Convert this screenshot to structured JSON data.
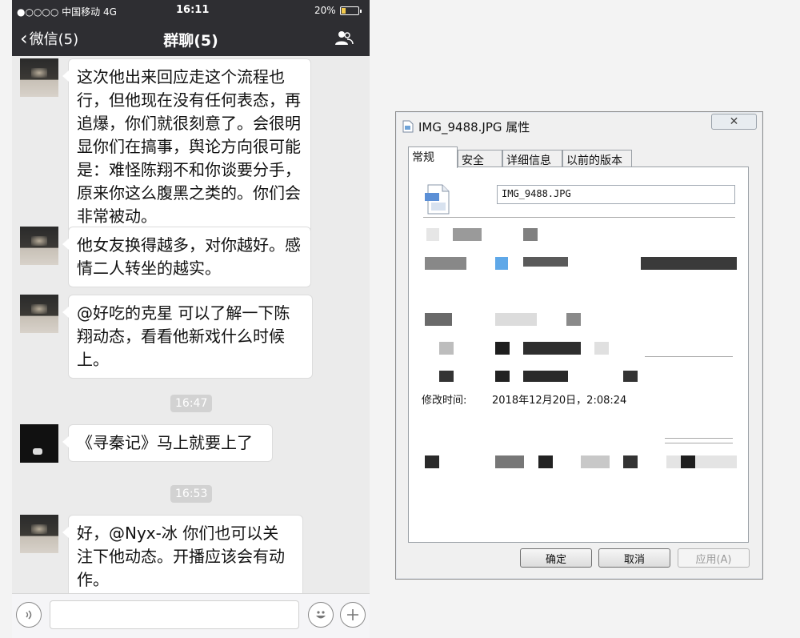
{
  "phone": {
    "status": {
      "carrier": "●○○○○ 中国移动  4G",
      "time": "16:11",
      "battery": "20%"
    },
    "nav": {
      "back_label": "微信(5)",
      "title": "群聊(5)"
    },
    "messages": [
      {
        "text": "这次他出来回应走这个流程也行，但他现在没有任何表态，再追爆，你们就很刻意了。会很明显你们在搞事，舆论方向很可能是：难怪陈翔不和你谈要分手，原来你这么腹黑之类的。你们会非常被动。"
      },
      {
        "text": "他女友换得越多，对你越好。感情二人转坐的越实。"
      },
      {
        "text": "@好吃的克星 可以了解一下陈翔动态，看看他新戏什么时候上。"
      },
      {
        "text": "《寻秦记》马上就要上了"
      },
      {
        "text": "好，@Nyx-冰 你们也可以关注下他动态。开播应该会有动作。"
      }
    ],
    "timestamps": [
      "16:47",
      "16:53"
    ],
    "input_placeholder": ""
  },
  "dialog": {
    "title": "IMG_9488.JPG 属性",
    "tabs": [
      "常规",
      "安全",
      "详细信息",
      "以前的版本"
    ],
    "filename": "IMG_9488.JPG",
    "modified_label": "修改时间:",
    "modified_value": "2018年12月20日，2:08:24",
    "buttons": {
      "ok": "确定",
      "cancel": "取消",
      "apply": "应用(A)"
    }
  },
  "colors": {
    "wechat_bar": "#2e2e32",
    "chat_bg": "#ebebeb",
    "bubble": "#ffffff"
  }
}
